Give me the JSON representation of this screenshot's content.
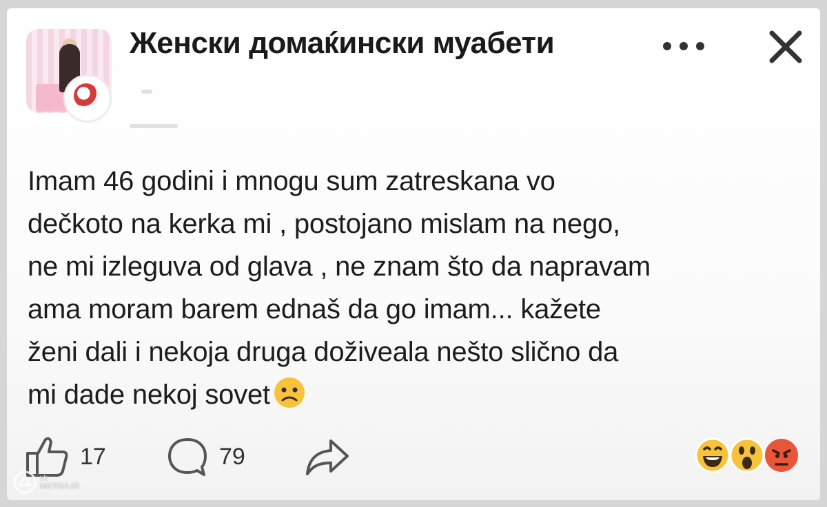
{
  "header": {
    "group_name": "Женски домаќински муабети",
    "more_icon": "more-dots-icon",
    "close_icon": "close-icon"
  },
  "post": {
    "text": "Imam 46 godini i mnogu sum zatreskana vo\ndečkoto na kerka mi , postojano mislam na nego,\nne mi izleguva od glava , ne znam što da napravam\nama moram barem ednaš da go imam... kažete\nženi dali i nekoja druga doživeala nešto slično da\nmi dade nekoj sovet",
    "emoji": "worried-face-emoji"
  },
  "actions": {
    "likes": "17",
    "comments": "79",
    "like_icon": "thumbs-up-icon",
    "comment_icon": "comment-bubble-icon",
    "share_icon": "share-arrow-icon"
  },
  "reactions": [
    "laughing-emoji",
    "wow-emoji",
    "angry-emoji"
  ],
  "watermark": {
    "line1": "vk",
    "line2": "MOTIKA.IO"
  }
}
